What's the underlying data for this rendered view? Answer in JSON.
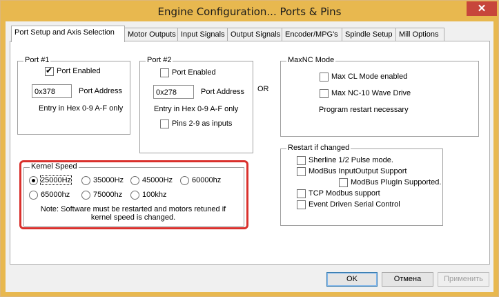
{
  "window": {
    "title": "Engine Configuration... Ports & Pins",
    "close_glyph": "✕"
  },
  "tabs": [
    {
      "label": "Port Setup and Axis Selection",
      "active": true
    },
    {
      "label": "Motor Outputs"
    },
    {
      "label": "Input Signals"
    },
    {
      "label": "Output Signals"
    },
    {
      "label": "Encoder/MPG's"
    },
    {
      "label": "Spindle Setup"
    },
    {
      "label": "Mill Options"
    }
  ],
  "port1": {
    "group_label": "Port #1",
    "enabled_label": "Port Enabled",
    "enabled": true,
    "address_value": "0x378",
    "address_label": "Port Address",
    "hint": "Entry in Hex 0-9 A-F only"
  },
  "port2": {
    "group_label": "Port #2",
    "enabled_label": "Port Enabled",
    "enabled": false,
    "address_value": "0x278",
    "address_label": "Port Address",
    "hint": "Entry in Hex 0-9 A-F only",
    "pins_label": "Pins 2-9 as inputs",
    "pins_checked": false
  },
  "or_label": "OR",
  "maxnc": {
    "group_label": "MaxNC Mode",
    "max_cl_label": "Max CL Mode enabled",
    "max_nc10_label": "Max NC-10 Wave Drive",
    "note": "Program restart necessary"
  },
  "kernel": {
    "group_label": "Kernel Speed",
    "options": [
      "25000Hz",
      "35000Hz",
      "45000Hz",
      "60000hz",
      "65000hz",
      "75000hz",
      "100khz"
    ],
    "selected": "25000Hz",
    "note_line1": "Note: Software must be restarted and motors retuned if",
    "note_line2": "kernel speed is changed."
  },
  "restart": {
    "group_label": "Restart if changed",
    "sherline_label": "Sherline 1/2 Pulse mode.",
    "modbus_io_label": "ModBus InputOutput Support",
    "modbus_plugin_label": "ModBus PlugIn Supported.",
    "tcp_label": "TCP Modbus support",
    "event_label": "Event Driven Serial Control"
  },
  "buttons": {
    "ok": "OK",
    "cancel": "Отмена",
    "apply": "Применить"
  },
  "colors": {
    "title_bar": "#e8b84f",
    "close_button": "#c7463b",
    "highlight_border": "#d9302c"
  }
}
